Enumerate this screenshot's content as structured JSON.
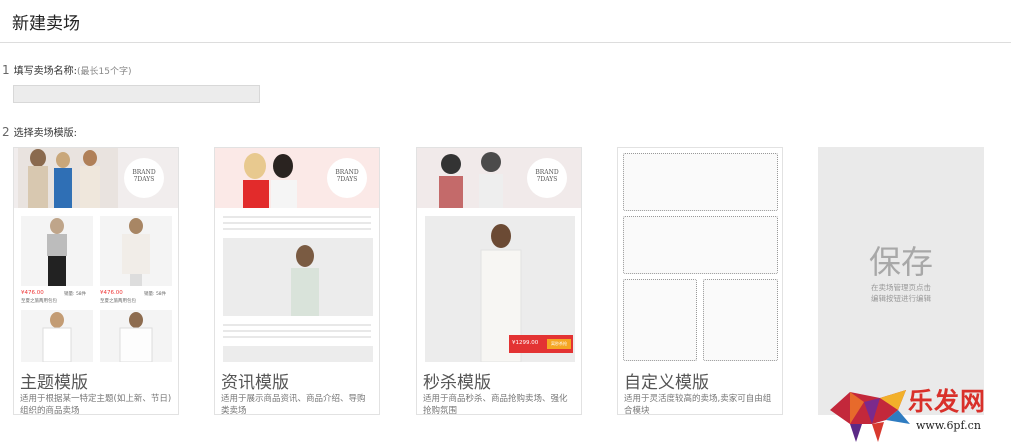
{
  "header": {
    "title": "新建卖场"
  },
  "step1": {
    "num": "1",
    "label": "填写卖场名称:",
    "hint": "(最长15个字)",
    "input_value": ""
  },
  "step2": {
    "num": "2",
    "label": "选择卖场模版:"
  },
  "cards": [
    {
      "name": "主题模版",
      "desc": "适用于根据某一特定主题(如上新、节日)组织的商品卖场",
      "brand": "BRAND",
      "brand2": "7DAYS",
      "price1": "¥476.00",
      "price2": "¥476.00",
      "sales1": "销量: 58件",
      "sales2": "销量: 58件",
      "item1": "至夏之旅两用包包",
      "item2": "至夏之旅两用包包"
    },
    {
      "name": "资讯模版",
      "desc": "适用于展示商品资讯、商品介绍、导购类卖场",
      "brand": "BRAND",
      "brand2": "7DAYS"
    },
    {
      "name": "秒杀模版",
      "desc": "适用于商品秒杀、商品抢购卖场、强化抢购氛围",
      "brand": "BRAND",
      "brand2": "7DAYS",
      "price": "¥1299.00",
      "buy_label": "离秒杀抢"
    },
    {
      "name": "自定义模版",
      "desc": "适用于灵活度较高的卖场,卖家可自由组合模块"
    }
  ],
  "save_card": {
    "title": "保存",
    "line1": "在卖场管理页点击",
    "line2": "编辑按钮进行编辑"
  },
  "watermark": {
    "text": "乐发网",
    "url": "www.6pf.cn"
  },
  "colors": {
    "price_red": "#e33333",
    "accent_orange": "#f5a623",
    "brand_red": "#d9302a"
  }
}
